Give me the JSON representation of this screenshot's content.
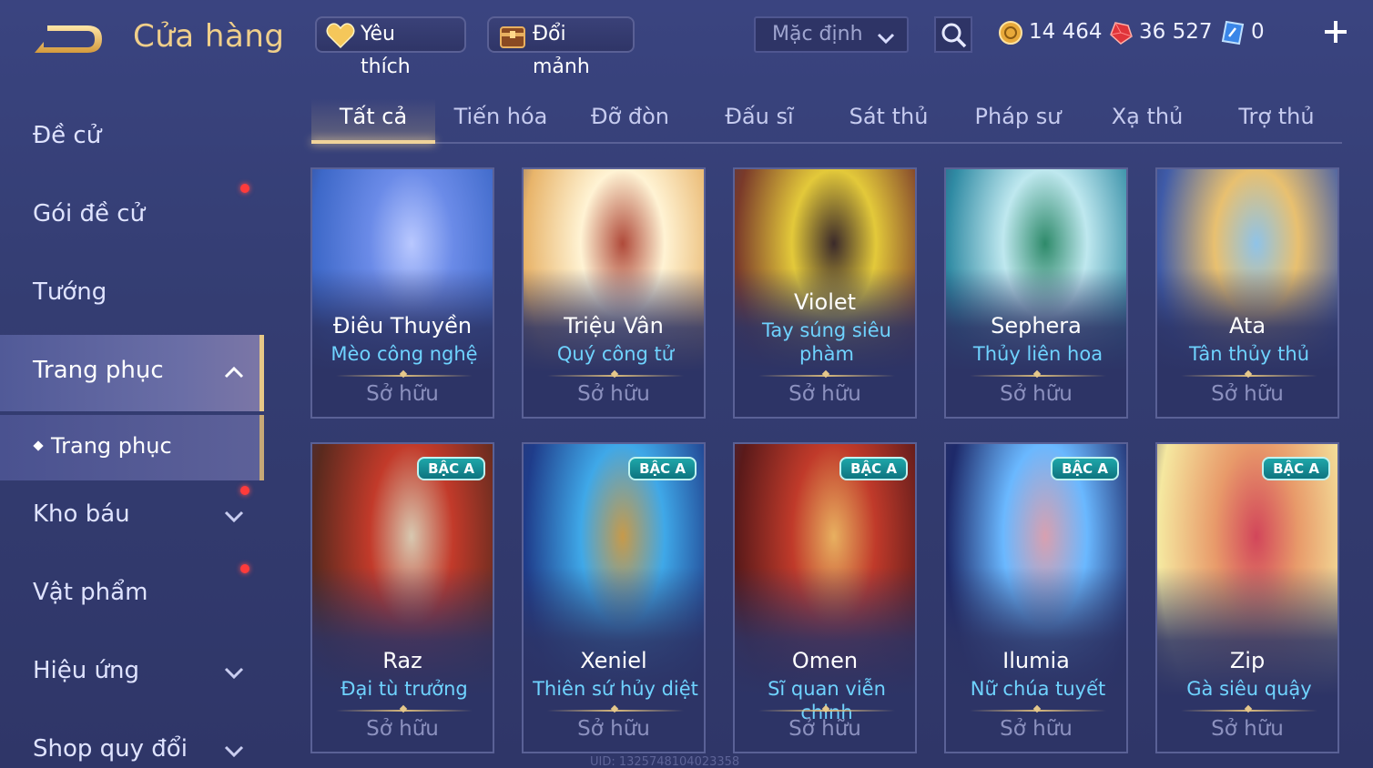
{
  "header": {
    "title": "Cửa hàng",
    "favorite_label": "Yêu thích",
    "shard_label": "Đổi mảnh",
    "sort_value": "Mặc định",
    "currencies": [
      {
        "name": "gold-coin",
        "value": "14 464",
        "color": "#f0c060"
      },
      {
        "name": "ruby",
        "value": "36 527",
        "color": "#e53935"
      },
      {
        "name": "voucher",
        "value": "0",
        "color": "#4aa8ff"
      }
    ]
  },
  "sidebar": {
    "items": [
      {
        "label": "Đề cử",
        "dot": false,
        "chevron": "none"
      },
      {
        "label": "Gói đề cử",
        "dot": true,
        "chevron": "none"
      },
      {
        "label": "Tướng",
        "dot": false,
        "chevron": "none"
      },
      {
        "label": "Trang phục",
        "dot": false,
        "chevron": "up",
        "active": true
      },
      {
        "label": "Kho báu",
        "dot": true,
        "chevron": "down"
      },
      {
        "label": "Vật phẩm",
        "dot": true,
        "chevron": "none"
      },
      {
        "label": "Hiệu ứng",
        "dot": false,
        "chevron": "down"
      },
      {
        "label": "Shop quy đổi",
        "dot": false,
        "chevron": "down"
      }
    ],
    "sub_item": "Trang phục"
  },
  "tabs": [
    "Tất cả",
    "Tiến hóa",
    "Đỡ đòn",
    "Đấu sĩ",
    "Sát thủ",
    "Pháp sư",
    "Xạ thủ",
    "Trợ thủ"
  ],
  "active_tab": "Tất cả",
  "cards": [
    {
      "hero": "Điêu Thuyền",
      "skin": "Mèo công nghệ",
      "status": "Sở hữu",
      "badge": "",
      "colors": [
        "#3d68c8",
        "#6b8be8",
        "#b9c8ff"
      ]
    },
    {
      "hero": "Triệu Vân",
      "skin": "Quý công tử",
      "status": "Sở hữu",
      "badge": "",
      "colors": [
        "#e8b46a",
        "#fff3d4",
        "#b04a3a"
      ]
    },
    {
      "hero": "Violet",
      "skin": "Tay súng siêu phàm",
      "status": "Sở hữu",
      "badge": "",
      "colors": [
        "#7a3a2a",
        "#e3c93a",
        "#3b2a2a"
      ]
    },
    {
      "hero": "Sephera",
      "skin": "Thủy liên hoa",
      "status": "Sở hữu",
      "badge": "",
      "colors": [
        "#2f8aa3",
        "#bfe8ef",
        "#2e8a6a"
      ]
    },
    {
      "hero": "Ata",
      "skin": "Tân thủy thủ",
      "status": "Sở hữu",
      "badge": "",
      "colors": [
        "#3f5ba8",
        "#e8c070",
        "#8fc3e8"
      ]
    },
    {
      "hero": "Raz",
      "skin": "Đại tù trưởng",
      "status": "Sở hữu",
      "badge": "BẬC A",
      "colors": [
        "#5a2a1e",
        "#c23a2a",
        "#d8c8b0"
      ]
    },
    {
      "hero": "Xeniel",
      "skin": "Thiên sứ hủy diệt",
      "status": "Sở hữu",
      "badge": "BẬC A",
      "colors": [
        "#1f3c8a",
        "#3fa8e8",
        "#c79a4a"
      ]
    },
    {
      "hero": "Omen",
      "skin": "Sĩ quan viễn chinh",
      "status": "Sở hữu",
      "badge": "BẬC A",
      "colors": [
        "#5a1a1a",
        "#c03a2a",
        "#e8b060"
      ]
    },
    {
      "hero": "Ilumia",
      "skin": "Nữ chúa tuyết",
      "status": "Sở hữu",
      "badge": "BẬC A",
      "colors": [
        "#1e2a6a",
        "#6ab8ff",
        "#d8a0b0"
      ]
    },
    {
      "hero": "Zip",
      "skin": "Gà siêu quậy",
      "status": "Sở hữu",
      "badge": "BẬC A",
      "colors": [
        "#f5e8a0",
        "#e89a6a",
        "#d2465a"
      ]
    }
  ],
  "footer": {
    "uid": "UID: 1325748104023358"
  }
}
